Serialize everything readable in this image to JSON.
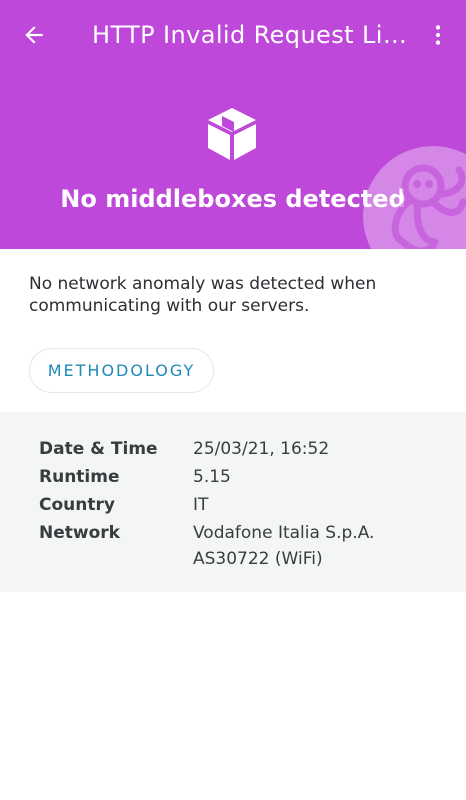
{
  "appbar": {
    "title": "HTTP Invalid Request Line",
    "back_icon": "arrow-left-icon",
    "menu_icon": "more-vertical-icon"
  },
  "header": {
    "background_color": "#bd48d9",
    "icon": "package-cube-icon",
    "headline": "No middleboxes detected",
    "mascot_icon": "octopus-mascot-icon"
  },
  "description": "No network anomaly was detected when communicating with our servers.",
  "methodology_label": "METHODOLOGY",
  "details": {
    "rows": [
      {
        "label": "Date & Time",
        "value": "25/03/21, 16:52"
      },
      {
        "label": "Runtime",
        "value": "5.15"
      },
      {
        "label": "Country",
        "value": "IT"
      },
      {
        "label": "Network",
        "value": "Vodafone Italia S.p.A.",
        "value2": "AS30722 (WiFi)"
      }
    ]
  }
}
